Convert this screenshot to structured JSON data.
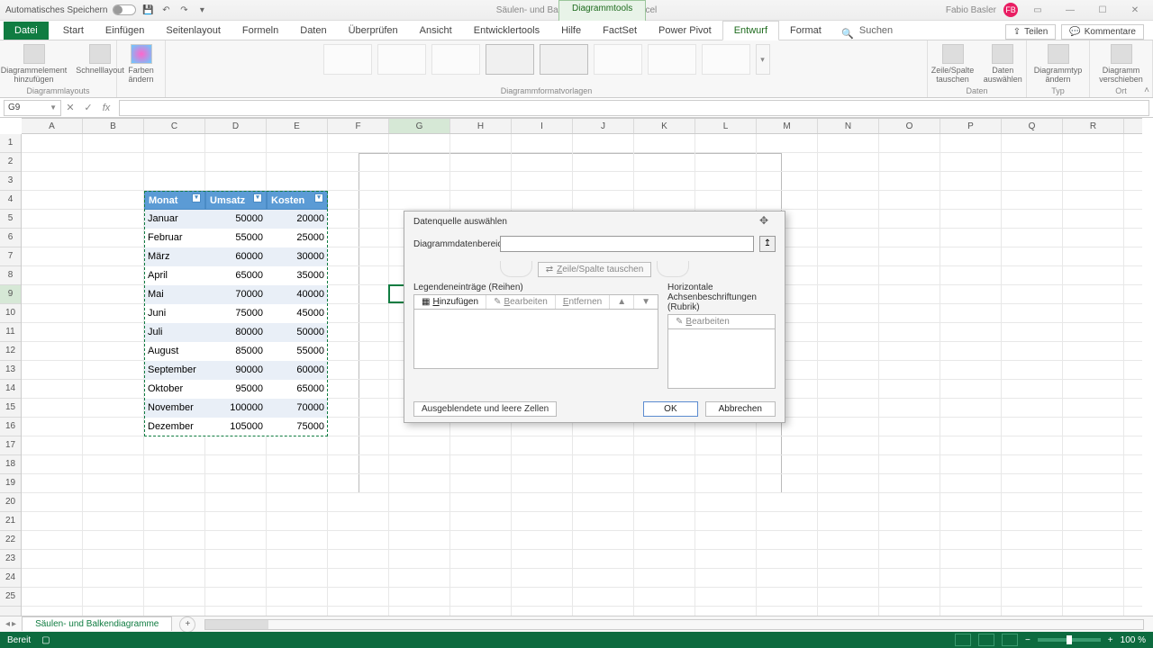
{
  "titlebar": {
    "autosave": "Automatisches Speichern",
    "doc": "Säulen- und Balkendiagramme",
    "app": "Excel",
    "context_tab": "Diagrammtools",
    "user": "Fabio Basler",
    "avatar": "FB"
  },
  "ribbon": {
    "file": "Datei",
    "tabs": [
      "Start",
      "Einfügen",
      "Seitenlayout",
      "Formeln",
      "Daten",
      "Überprüfen",
      "Ansicht",
      "Entwicklertools",
      "Hilfe",
      "FactSet",
      "Power Pivot",
      "Entwurf",
      "Format"
    ],
    "active": "Entwurf",
    "search": "Suchen",
    "share": "Teilen",
    "comments": "Kommentare",
    "groups": {
      "layouts": "Diagrammlayouts",
      "layouts_b1": "Diagrammelement hinzufügen",
      "layouts_b2": "Schnelllayout",
      "colors": "Farben ändern",
      "styles": "Diagrammformatvorlagen",
      "data": "Daten",
      "data_b1": "Zeile/Spalte tauschen",
      "data_b2": "Daten auswählen",
      "type": "Typ",
      "type_b1": "Diagrammtyp ändern",
      "loc": "Ort",
      "loc_b1": "Diagramm verschieben"
    }
  },
  "fx": {
    "cell_ref": "G9"
  },
  "columns": [
    "A",
    "B",
    "C",
    "D",
    "E",
    "F",
    "G",
    "H",
    "I",
    "J",
    "K",
    "L",
    "M",
    "N",
    "O",
    "P",
    "Q",
    "R"
  ],
  "table": {
    "headers": [
      "Monat",
      "Umsatz",
      "Kosten"
    ],
    "rows": [
      [
        "Januar",
        "50000",
        "20000"
      ],
      [
        "Februar",
        "55000",
        "25000"
      ],
      [
        "März",
        "60000",
        "30000"
      ],
      [
        "April",
        "65000",
        "35000"
      ],
      [
        "Mai",
        "70000",
        "40000"
      ],
      [
        "Juni",
        "75000",
        "45000"
      ],
      [
        "Juli",
        "80000",
        "50000"
      ],
      [
        "August",
        "85000",
        "55000"
      ],
      [
        "September",
        "90000",
        "60000"
      ],
      [
        "Oktober",
        "95000",
        "65000"
      ],
      [
        "November",
        "100000",
        "70000"
      ],
      [
        "Dezember",
        "105000",
        "75000"
      ]
    ]
  },
  "dialog": {
    "title": "Datenquelle auswählen",
    "range_label": "Diagrammdatenbereich:",
    "range_value": "",
    "swap": "Zeile/Spalte tauschen",
    "legend_title": "Legendeneinträge (Reihen)",
    "legend_add": "Hinzufügen",
    "legend_edit": "Bearbeiten",
    "legend_remove": "Entfernen",
    "axis_title": "Horizontale Achsenbeschriftungen (Rubrik)",
    "axis_edit": "Bearbeiten",
    "hidden": "Ausgeblendete und leere Zellen",
    "ok": "OK",
    "cancel": "Abbrechen"
  },
  "sheet": {
    "name": "Säulen- und Balkendiagramme"
  },
  "status": {
    "ready": "Bereit",
    "zoom": "100 %"
  }
}
